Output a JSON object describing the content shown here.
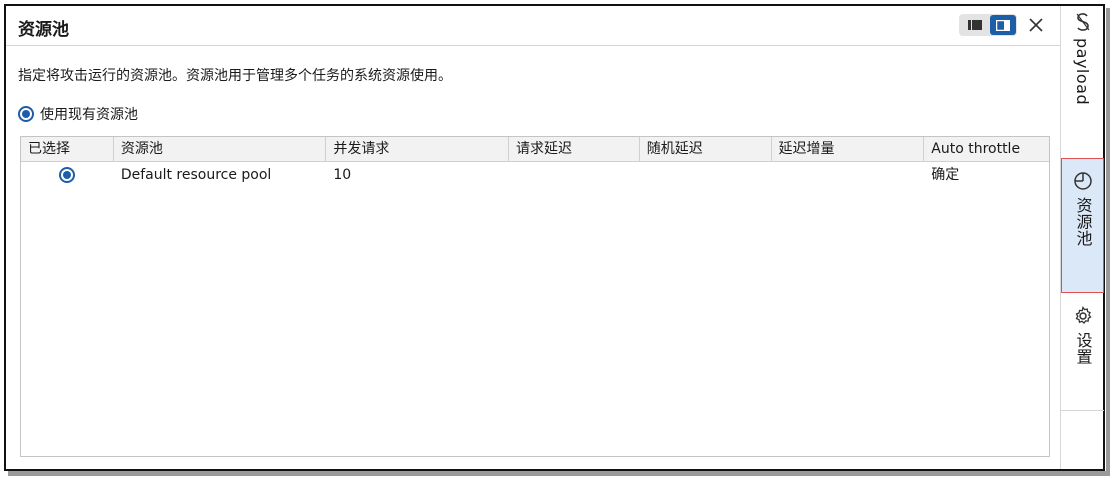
{
  "panel": {
    "title": "资源池",
    "description": "指定将攻击运行的资源池。资源池用于管理多个任务的系统资源使用。",
    "use_existing_label": "使用现有资源池"
  },
  "table": {
    "columns": [
      "已选择",
      "资源池",
      "并发请求",
      "请求延迟",
      "随机延迟",
      "延迟增量",
      "Auto throttle"
    ],
    "rows": [
      {
        "selected": true,
        "pool": "Default resource pool",
        "concurrent": "10",
        "request_delay": "",
        "random_delay": "",
        "delay_increment": "",
        "auto_throttle": "确定"
      }
    ]
  },
  "sidebar": {
    "tabs": [
      {
        "label": "payload",
        "icon": "payload-s-icon",
        "active": false
      },
      {
        "label": "资源池",
        "icon": "pie-chart-icon",
        "active": true
      },
      {
        "label": "设置",
        "icon": "gear-icon",
        "active": false
      }
    ]
  },
  "colors": {
    "accent": "#1d5ea8",
    "active_tab_bg": "#dbe8f8",
    "highlight_border": "#e05050"
  }
}
